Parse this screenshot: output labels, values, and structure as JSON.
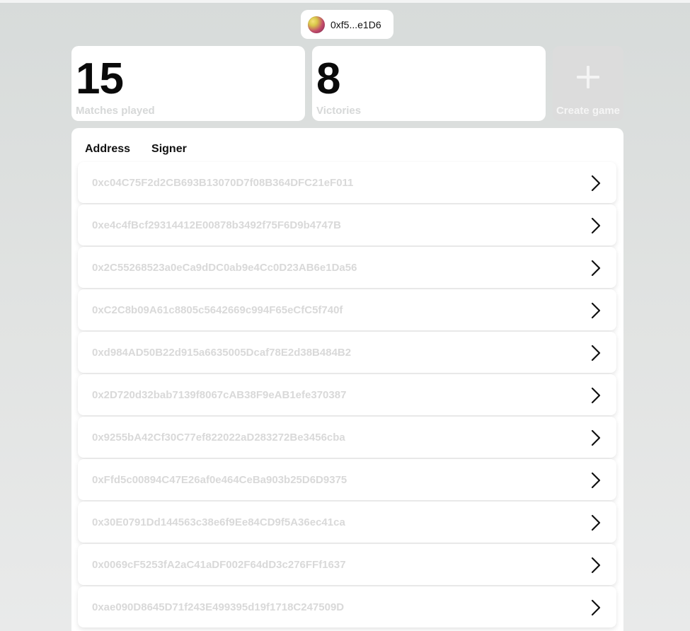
{
  "wallet": {
    "address_short": "0xf5...e1D6"
  },
  "stats": {
    "matches_played": {
      "value": "15",
      "label": "Matches played"
    },
    "victories": {
      "value": "8",
      "label": "Victories"
    }
  },
  "create_game": {
    "label": "Create game",
    "icon": "plus-icon"
  },
  "table": {
    "headers": [
      "Address",
      "Signer"
    ],
    "rows": [
      "0xc04C75F2d2CB693B13070D7f08B364DFC21eF011",
      "0xe4c4fBcf29314412E00878b3492f75F6D9b4747B",
      "0x2C55268523a0eCa9dDC0ab9e4Cc0D23AB6e1Da56",
      "0xC2C8b09A61c8805c5642669c994F65eCfC5f740f",
      "0xd984AD50B22d915a6635005Dcaf78E2d38B484B2",
      "0x2D720d32bab7139f8067cAB38F9eAB1efe370387",
      "0x9255bA42Cf30C77ef822022aD283272Be3456cba",
      "0xFfd5c00894C47E26af0e464CeBa903b25D6D9375",
      "0x30E0791Dd144563c38e6f9Ee84CD9f5A36ec41ca",
      "0x0069cF5253fA2aC41aDF002F64dD3c276FFf1637",
      "0xae090D8645D71f243E499395d19f1718C247509D"
    ]
  }
}
